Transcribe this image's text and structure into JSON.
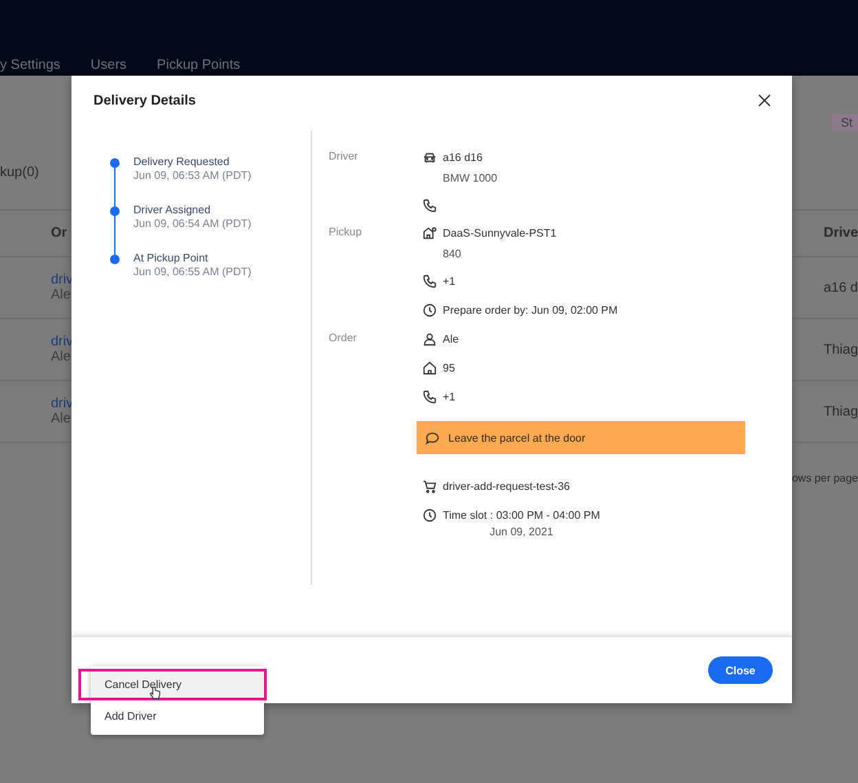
{
  "background": {
    "nav": [
      "y Settings",
      "Users",
      "Pickup Points"
    ],
    "tag": "St",
    "filter_count": "kup(0)",
    "columns": [
      "Or",
      "Drive"
    ],
    "rows": [
      {
        "order": "driv",
        "customer": "Ale",
        "driver": "a16 d"
      },
      {
        "order": "driv",
        "customer": "Ale",
        "driver": "Thiag"
      },
      {
        "order": "driv",
        "customer": "Ale",
        "driver": "Thiag"
      }
    ],
    "pagination": "ows per page"
  },
  "modal": {
    "title": "Delivery Details",
    "timeline": [
      {
        "label": "Delivery Requested",
        "time": "Jun 09, 06:53 AM (PDT)"
      },
      {
        "label": "Driver Assigned",
        "time": "Jun 09, 06:54 AM (PDT)"
      },
      {
        "label": "At Pickup Point",
        "time": "Jun 09, 06:55 AM (PDT)"
      }
    ],
    "sections": [
      {
        "label": "Driver",
        "rows": [
          {
            "kind": "vehicle",
            "text": "a16 d16",
            "sub": "BMW 1000"
          },
          {
            "kind": "phone"
          }
        ]
      },
      {
        "label": "Pickup",
        "rows": [
          {
            "kind": "location",
            "text": "DaaS-Sunnyvale-PST1",
            "sub": "840"
          },
          {
            "kind": "phone",
            "text": "+1"
          },
          {
            "kind": "deadline",
            "text": "Prepare order by: Jun 09, 02:00 PM"
          }
        ]
      },
      {
        "label": "Order",
        "rows": [
          {
            "kind": "customer",
            "text": "Ale"
          },
          {
            "kind": "address",
            "text": "95"
          },
          {
            "kind": "phone",
            "text": "+1"
          },
          {
            "kind": "note",
            "text": "Leave the parcel at the door"
          },
          {
            "kind": "order_id",
            "text": "driver-add-request-test-36"
          },
          {
            "kind": "time_slot",
            "text": "Time slot : 03:00 PM - 04:00 PM",
            "sub": "Jun 09, 2021"
          }
        ]
      }
    ],
    "close_button": "Close"
  },
  "menu": [
    {
      "label": "Cancel Delivery",
      "selected": true
    },
    {
      "label": "Add Driver",
      "selected": false
    }
  ]
}
